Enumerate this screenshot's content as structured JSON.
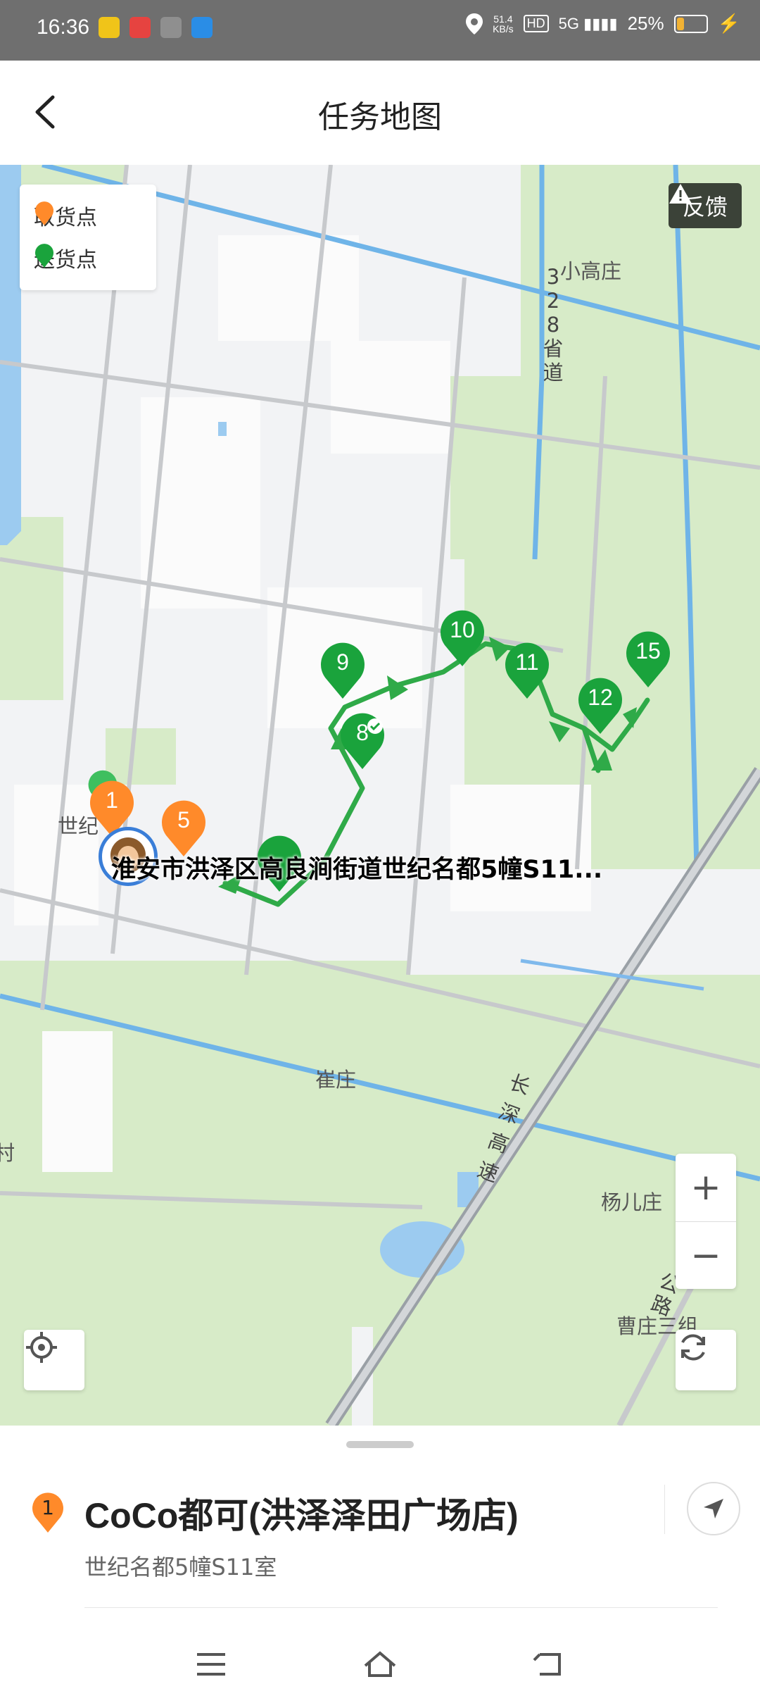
{
  "status_bar": {
    "time": "16:36",
    "net_speed": "51.4",
    "net_unit": "KB/s",
    "hd": "HD",
    "signal": "5G",
    "battery_pct": "25%",
    "battery_level": 0.25
  },
  "header": {
    "title": "任务地图",
    "back_icon": "chevron-left-icon"
  },
  "legend": {
    "pickup_label": "取货点",
    "delivery_label": "送货点",
    "pickup_color": "#ff8a2a",
    "delivery_color": "#1aa33c"
  },
  "feedback_label": "反馈",
  "map": {
    "road_labels": {
      "xiaogaozhuang": "小高庄",
      "road328": [
        "3",
        "2",
        "8",
        "省",
        "道"
      ],
      "cuizhuang": "崔庄",
      "changshen": [
        "长",
        "深",
        "高",
        "速"
      ],
      "yanger": "杨儿庄",
      "caozhuang": "曹庄三组",
      "shiji": "世纪",
      "gonglu": [
        "公",
        "路"
      ],
      "cun": "村"
    },
    "pickup_markers": [
      "1",
      "5"
    ],
    "delivery_markers": [
      "8",
      "9",
      "10",
      "11",
      "12",
      "15"
    ],
    "current_address": "淮安市洪泽区高良涧街道世纪名都5幢S11..."
  },
  "controls": {
    "zoom_in": "+",
    "zoom_out": "−"
  },
  "bottom_sheet": {
    "index": "1",
    "shop_name": "CoCo都可(洪泽泽田广场店)",
    "shop_address": "世纪名都5幢S11室"
  }
}
